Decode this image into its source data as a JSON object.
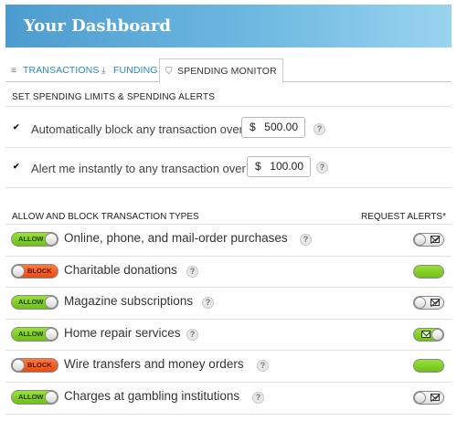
{
  "header": {
    "title": "Your Dashboard"
  },
  "tabs": [
    {
      "label": "TRANSACTIONS",
      "icon": "list-icon"
    },
    {
      "label": "FUNDING",
      "icon": "download-icon"
    },
    {
      "label": "SPENDING MONITOR",
      "icon": "shield-icon",
      "active": true
    }
  ],
  "limits": {
    "section_title": "SET SPENDING LIMITS & SPENDING ALERTS",
    "rows": [
      {
        "checked": true,
        "label": "Automatically block any transaction over",
        "currency": "$",
        "amount": "500.00"
      },
      {
        "checked": true,
        "label": "Alert me instantly to any transaction over",
        "currency": "$",
        "amount": "100.00"
      }
    ]
  },
  "types": {
    "section_title": "ALLOW AND BLOCK TRANSACTION TYPES",
    "alerts_header": "REQUEST ALERTS*",
    "help_glyph": "?",
    "rows": [
      {
        "status": "ALLOW",
        "label": "Online, phone, and mail-order purchases",
        "alert": "off"
      },
      {
        "status": "BLOCK",
        "label": "Charitable donations",
        "alert": "on"
      },
      {
        "status": "ALLOW",
        "label": "Magazine subscriptions",
        "alert": "off"
      },
      {
        "status": "ALLOW",
        "label": "Home repair services",
        "alert": "on-envelope"
      },
      {
        "status": "BLOCK",
        "label": "Wire transfers and money orders",
        "alert": "on"
      },
      {
        "status": "ALLOW",
        "label": "Charges at gambling institutions",
        "alert": "off"
      }
    ]
  },
  "colors": {
    "header_start": "#4d9ccf",
    "header_end": "#9ad4ef",
    "tab_link": "#2a88c7",
    "allow_green": "#7fcf26",
    "block_orange": "#f05a1e"
  }
}
